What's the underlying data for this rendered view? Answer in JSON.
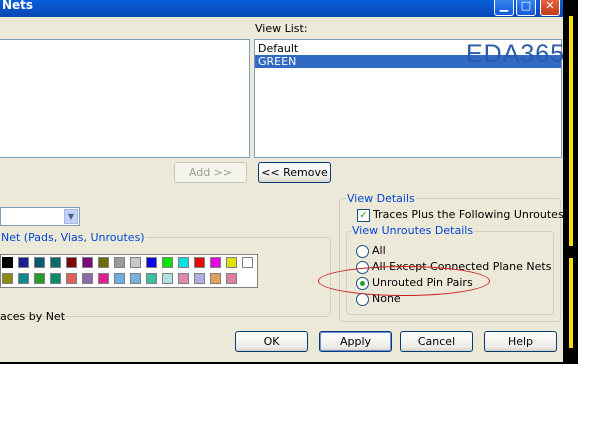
{
  "window": {
    "title": "Nets"
  },
  "view_list": {
    "label": "View List:",
    "items": [
      {
        "label": "Default",
        "selected": false
      },
      {
        "label": "GREEN",
        "selected": true
      }
    ]
  },
  "buttons": {
    "add": "Add >>",
    "remove": "<< Remove",
    "ok": "OK",
    "apply": "Apply",
    "cancel": "Cancel",
    "help": "Help"
  },
  "net_group_label": "Net (Pads, Vias, Unroutes)",
  "traces_label": "aces by Net",
  "view_details": {
    "group_label": "View Details",
    "traces_check_label": "Traces Plus the Following Unroutes:",
    "traces_checked": true,
    "unroutes_group_label": "View Unroutes Details",
    "options": [
      {
        "label": "All",
        "selected": false
      },
      {
        "label": "All Except Connected Plane Nets",
        "selected": false
      },
      {
        "label": "Unrouted Pin Pairs",
        "selected": true
      },
      {
        "label": "None",
        "selected": false
      }
    ]
  },
  "watermark": "EDA365",
  "palette_row1": [
    "#000000",
    "#1a1f8c",
    "#0a5a6a",
    "#0a6b6b",
    "#7a0a0a",
    "#7a0a7a",
    "#6b6b0a",
    "#9a9a9a",
    "#c8c8c8",
    "#0a0ae0",
    "#0ae00a",
    "#0ae0e0",
    "#e00a0a",
    "#e00ae0",
    "#e0e00a",
    "#ffffff"
  ],
  "palette_row2": [
    "#8a8a0a",
    "#0a8a8a",
    "#2a9a2a",
    "#0a8a6a",
    "#e06060",
    "#8a6aa8",
    "#e0208a",
    "#6ab0e0",
    "#7ab0e0",
    "#3ac0a0",
    "#b0e0e0",
    "#e08ab0",
    "#b0b0e0",
    "#e0a060",
    "#e080a0"
  ]
}
